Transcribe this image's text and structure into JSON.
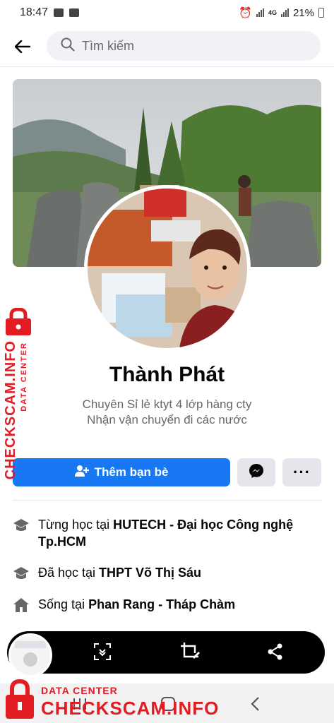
{
  "status_bar": {
    "time": "18:47",
    "battery": "21%",
    "network": "4G"
  },
  "header": {
    "search_placeholder": "Tìm kiếm"
  },
  "profile": {
    "name": "Thành Phát",
    "bio_line1": "Chuyên Sỉ lẻ ktyt 4 lớp hàng cty",
    "bio_line2": "Nhận vận chuyển đi các nước"
  },
  "actions": {
    "add_friend_label": "Thêm bạn bè",
    "more_label": "···"
  },
  "intro": [
    {
      "icon": "graduation-cap-icon",
      "prefix": "Từng học tại ",
      "bold": "HUTECH - Đại học Công nghệ Tp.HCM"
    },
    {
      "icon": "graduation-cap-icon",
      "prefix": "Đã học tại ",
      "bold": "THPT Võ Thị Sáu"
    },
    {
      "icon": "home-icon",
      "prefix": "Sống tại ",
      "bold": "Phan Rang - Tháp Chàm"
    }
  ],
  "watermark": {
    "small": "DATA CENTER",
    "big": "CHECKSCAM.INFO"
  },
  "colors": {
    "accent": "#1877f2",
    "watermark": "#e31b23",
    "secondary_text": "#65676b"
  }
}
